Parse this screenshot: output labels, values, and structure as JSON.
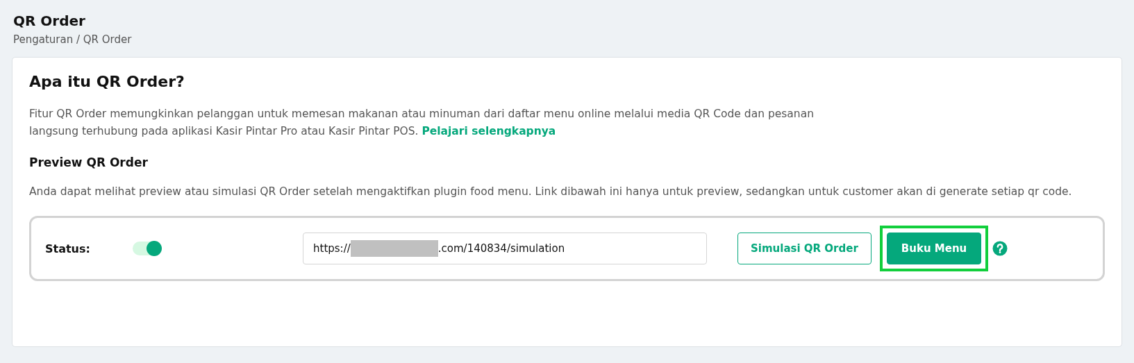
{
  "header": {
    "title": "QR Order",
    "breadcrumb": "Pengaturan / QR Order"
  },
  "card": {
    "heading": "Apa itu QR Order?",
    "intro_line_1": "Fitur QR Order memungkinkan pelanggan untuk memesan makanan atau minuman dari daftar menu online melalui media QR Code dan pesanan",
    "intro_line_2": "langsung terhubung pada aplikasi Kasir Pintar Pro atau Kasir Pintar POS.",
    "learn_more_link": "Pelajari selengkapnya",
    "subheading": "Preview QR Order",
    "description": "Anda dapat melihat preview atau simulasi QR Order setelah mengaktifkan plugin food menu. Link dibawah ini hanya untuk preview, sedangkan untuk customer akan di generate setiap qr code.",
    "status": {
      "label": "Status:",
      "on": true,
      "url_prefix": "https://",
      "url_redacted": true,
      "url_suffix": ".com/140834/simulation"
    },
    "buttons": [
      {
        "kind": "outline",
        "label": "Simulasi QR Order",
        "highlighted": false
      },
      {
        "kind": "solid",
        "label": "Buku Menu",
        "highlighted": true
      }
    ]
  }
}
